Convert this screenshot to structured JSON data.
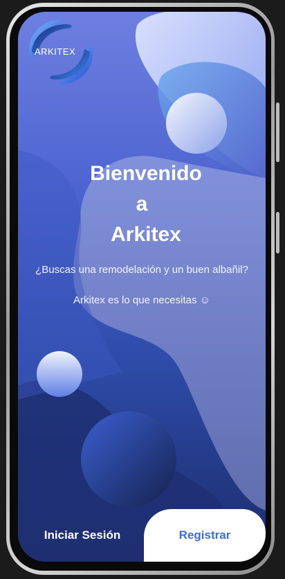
{
  "app": {
    "logo_text": "ARKITEX"
  },
  "hero": {
    "title_line1": "Bienvenido",
    "title_line2": "a",
    "title_line3": "Arkitex",
    "subtitle": "¿Buscas una remodelación y un buen albañil?",
    "tagline": "Arkitex es lo que necesitas ☺"
  },
  "actions": {
    "login_label": "Iniciar Sesión",
    "register_label": "Registrar"
  },
  "colors": {
    "accent": "#3d6cd6",
    "background_top": "#6e7fe0",
    "background_bottom": "#1b2c6a"
  }
}
